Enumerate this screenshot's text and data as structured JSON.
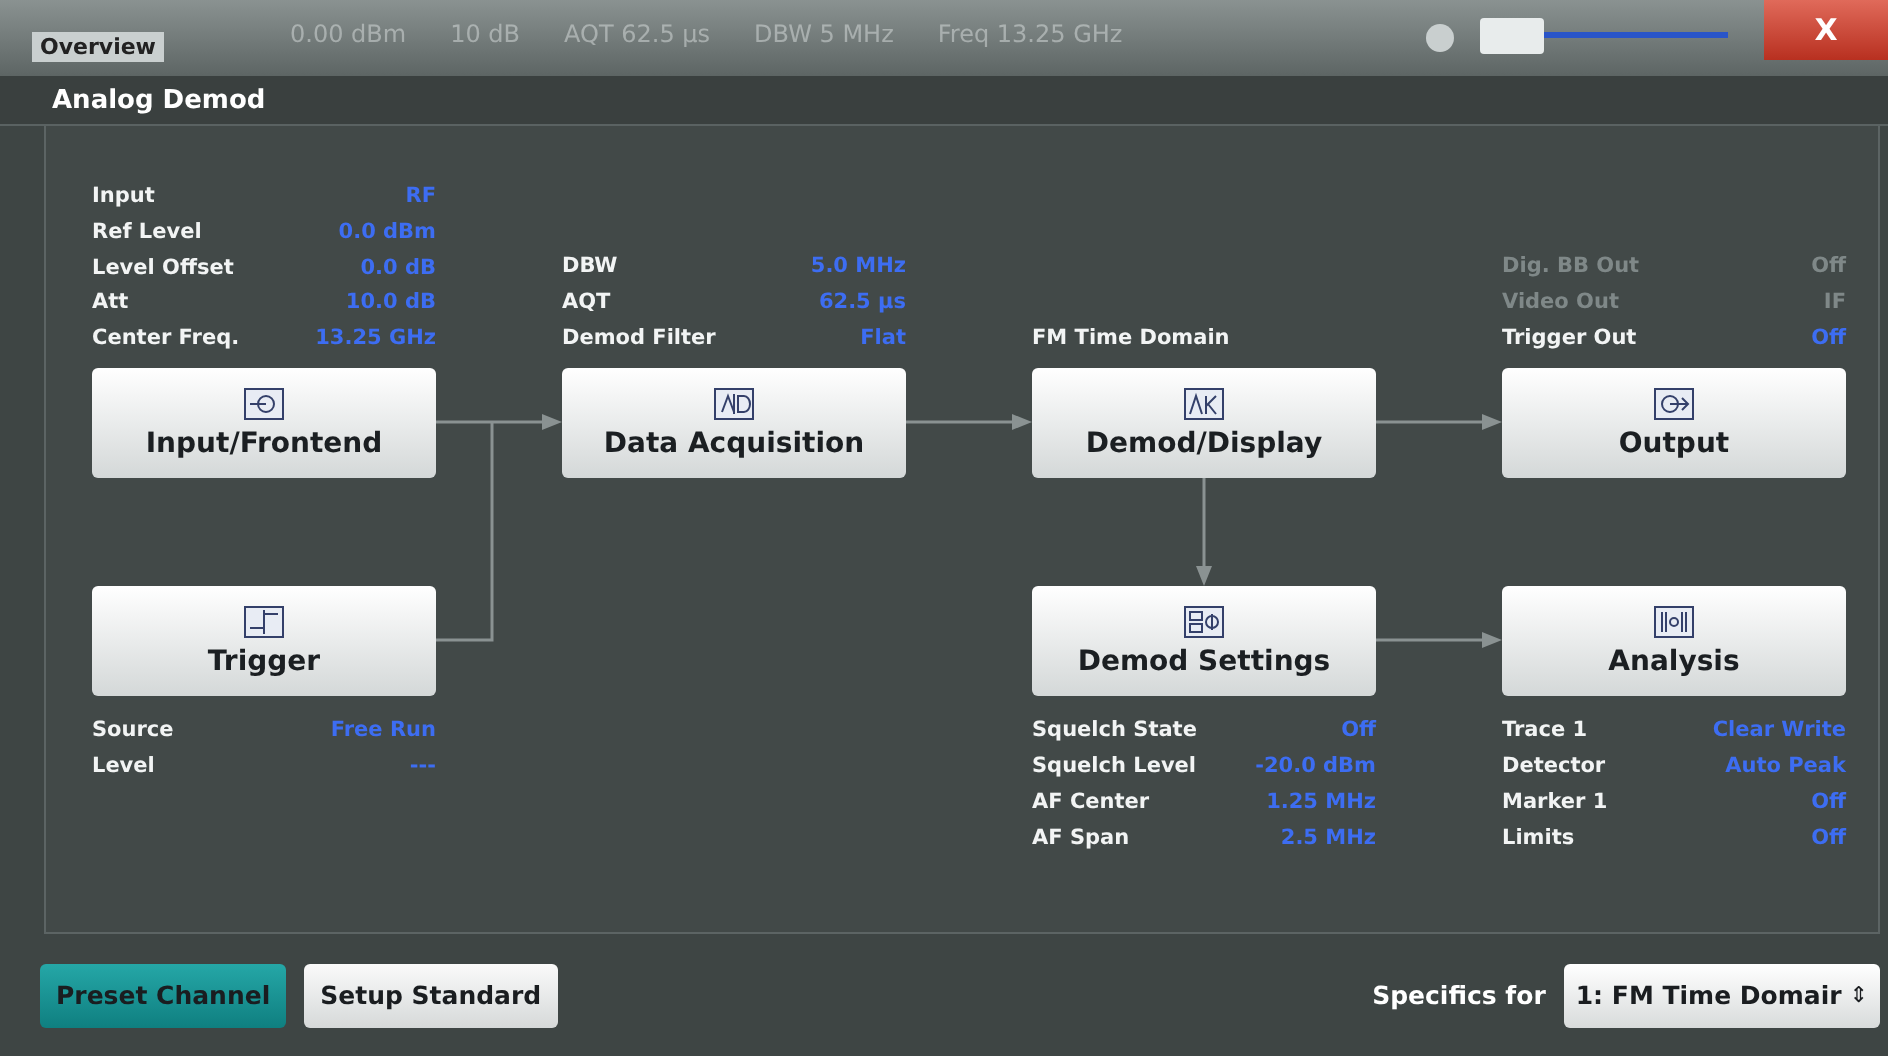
{
  "background_header": {
    "texts": [
      "0.00 dBm",
      "10 dB",
      "AQT 62.5 µs",
      "DBW 5 MHz",
      "Freq 13.25 GHz"
    ]
  },
  "dialog": {
    "tab": "Overview",
    "close": "X",
    "title": "Analog Demod"
  },
  "columns": [
    {
      "top": [
        {
          "label": "Input",
          "value": "RF",
          "disabled": false
        },
        {
          "label": "Ref Level",
          "value": "0.0 dBm",
          "disabled": false
        },
        {
          "label": "Level Offset",
          "value": "0.0 dB",
          "disabled": false
        },
        {
          "label": "Att",
          "value": "10.0 dB",
          "disabled": false
        },
        {
          "label": "Center Freq.",
          "value": "13.25 GHz",
          "disabled": false
        }
      ],
      "upper_block": {
        "label": "Input/Frontend",
        "kind": "input"
      },
      "lower_block": {
        "label": "Trigger",
        "kind": "trigger"
      },
      "bottom": [
        {
          "label": "Source",
          "value": "Free Run",
          "disabled": false
        },
        {
          "label": "Level",
          "value": "---",
          "disabled": false
        }
      ]
    },
    {
      "top": [
        {
          "label": "DBW",
          "value": "5.0 MHz",
          "disabled": false
        },
        {
          "label": "AQT",
          "value": "62.5 µs",
          "disabled": false
        },
        {
          "label": "Demod Filter",
          "value": "Flat",
          "disabled": false
        }
      ],
      "upper_block": {
        "label": "Data Acquisition",
        "kind": "adc"
      }
    },
    {
      "top": [
        {
          "label": "FM Time Domain",
          "disabled": false
        }
      ],
      "upper_block": {
        "label": "Demod/Display",
        "kind": "display"
      },
      "lower_block": {
        "label": "Demod Settings",
        "kind": "demod"
      },
      "bottom": [
        {
          "label": "Squelch State",
          "value": "Off",
          "disabled": false
        },
        {
          "label": "Squelch Level",
          "value": "-20.0 dBm",
          "disabled": false
        },
        {
          "label": "AF Center",
          "value": "1.25 MHz",
          "disabled": false
        },
        {
          "label": "AF Span",
          "value": "2.5 MHz",
          "disabled": false
        }
      ]
    },
    {
      "top": [
        {
          "label": "Dig. BB Out",
          "value": "Off",
          "disabled": true
        },
        {
          "label": "Video Out",
          "value": "IF",
          "disabled": true
        },
        {
          "label": "Trigger Out",
          "value": "Off",
          "disabled": false
        }
      ],
      "upper_block": {
        "label": "Output",
        "kind": "output"
      },
      "lower_block": {
        "label": "Analysis",
        "kind": "analysis"
      },
      "bottom": [
        {
          "label": "Trace 1",
          "value": "Clear Write",
          "disabled": false
        },
        {
          "label": "Detector",
          "value": "Auto Peak",
          "disabled": false
        },
        {
          "label": "Marker 1",
          "value": "Off",
          "disabled": false
        },
        {
          "label": "Limits",
          "value": "Off",
          "disabled": false
        }
      ]
    }
  ],
  "footer": {
    "buttons": [
      {
        "label": "Preset Channel",
        "kind": "primary"
      },
      {
        "label": "Setup Standard",
        "kind": "secondary"
      }
    ],
    "specifics_label": "Specifics for",
    "specifics_value": "1: FM Time Domair",
    "select_arrow": "⇕"
  }
}
